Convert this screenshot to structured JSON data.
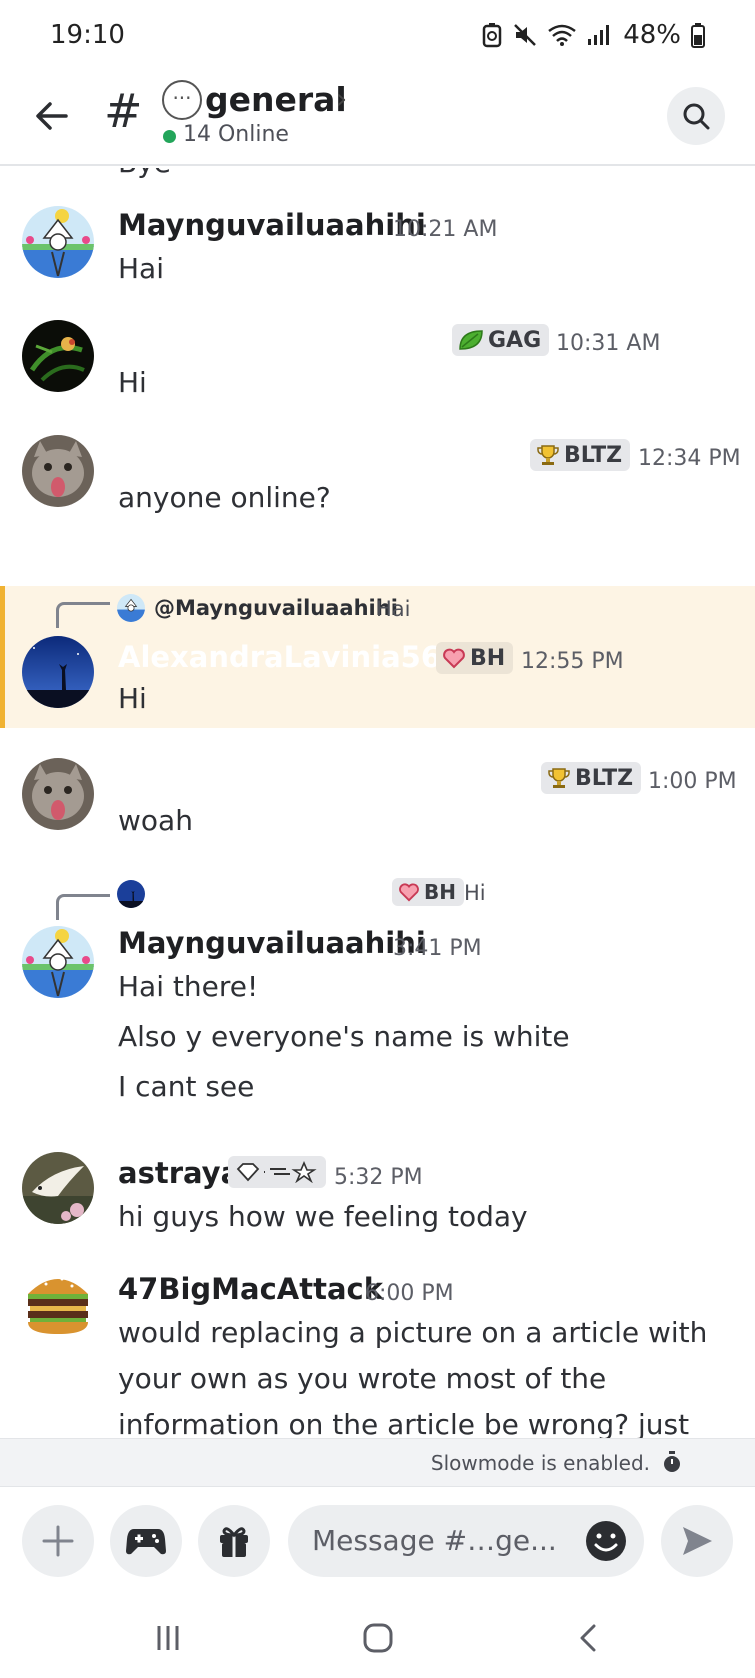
{
  "status_bar": {
    "time": "19:10",
    "battery": "48%"
  },
  "header": {
    "channel_name": "general",
    "online_count": "14 Online"
  },
  "cut_off_text": "Bye",
  "messages": [
    {
      "author": "Maynguvailuaahihi",
      "time": "10:21 AM",
      "lines": [
        "Hai"
      ]
    },
    {
      "author": "",
      "tag": "GAG",
      "time": "10:31 AM",
      "lines": [
        "Hi"
      ]
    },
    {
      "author": "",
      "tag": "BLTZ",
      "time": "12:34 PM",
      "lines": [
        "anyone online?"
      ]
    },
    {
      "reply_to": "@Maynguvailuaahihi",
      "reply_text": "Hai",
      "author": "AlexandraLavinia5637",
      "tag": "BH",
      "time": "12:55 PM",
      "lines": [
        "Hi"
      ]
    },
    {
      "author": "",
      "tag": "BLTZ",
      "time": "1:00 PM",
      "lines": [
        "woah"
      ]
    },
    {
      "reply_tag": "BH",
      "reply_text": "Hi",
      "author": "Maynguvailuaahihi",
      "time": "3:41 PM",
      "lines": [
        "Hai there!",
        "Also y everyone's name is white",
        "I cant see"
      ]
    },
    {
      "author": "astraya",
      "time": "5:32 PM",
      "lines": [
        "hi guys how we feeling today"
      ]
    },
    {
      "author": "47BigMacAttack",
      "time": "6:00 PM",
      "lines": [
        "would replacing a picture on a article with",
        "your own as you wrote most of the",
        "information on the article be wrong? just"
      ]
    }
  ],
  "slowmode_text": "Slowmode is enabled.",
  "composer": {
    "placeholder": "Message #…ge..."
  },
  "colors": {
    "online": "#23a55a",
    "highlight_bg": "#fdf4e4",
    "highlight_bar": "#f0b232",
    "tag_bg": "#e6e7ea"
  }
}
